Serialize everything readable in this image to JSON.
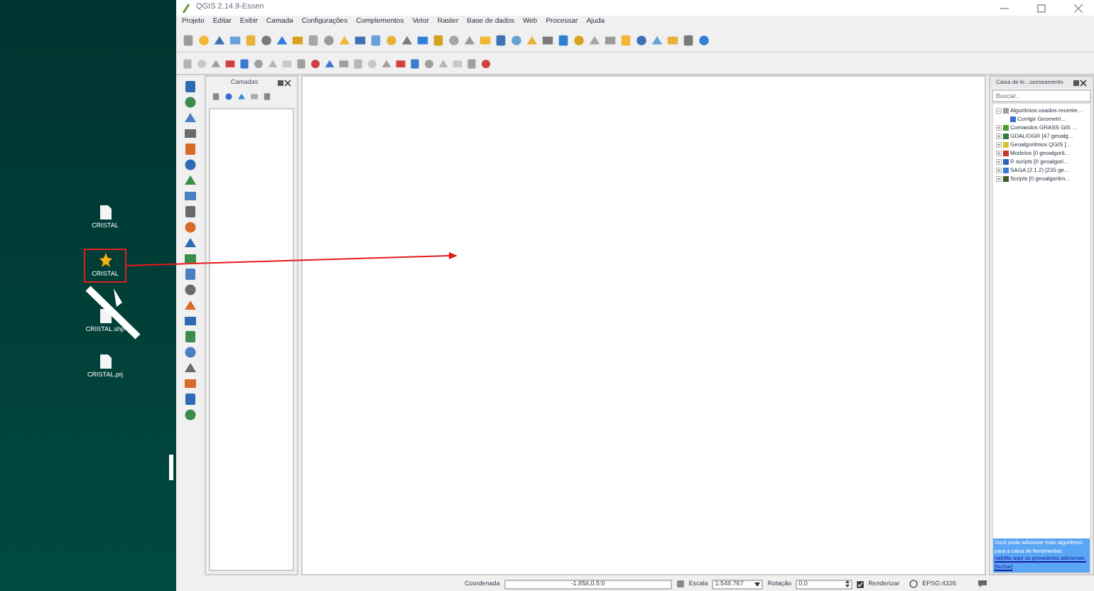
{
  "desktop": {
    "icons": [
      {
        "label": "CRISTAL",
        "kind": "file",
        "selected": false
      },
      {
        "label": "CRISTAL",
        "kind": "qgis",
        "selected": true
      },
      {
        "label": "CRISTAL.shp",
        "kind": "file",
        "selected": false
      },
      {
        "label": "CRISTAL.prj",
        "kind": "file",
        "selected": false
      }
    ]
  },
  "window": {
    "title": "QGIS 2.14.9-Essen"
  },
  "menu": [
    "Projeto",
    "Editar",
    "Exibir",
    "Camada",
    "Configurações",
    "Complementos",
    "Vetor",
    "Raster",
    "Base de dados",
    "Web",
    "Processar",
    "Ajuda"
  ],
  "layers_panel": {
    "title": "Camadas"
  },
  "processing_panel": {
    "title": "Caixa de fe...ocessamento",
    "search": {
      "placeholder": "Buscar..."
    },
    "tree": [
      {
        "label": "Algoritmos usados recente...",
        "expanded": true,
        "color": "#9aa0a6",
        "children": [
          {
            "label": "Corrigir Geometri...",
            "color": "#3b6fd1"
          }
        ]
      },
      {
        "label": "Comandos GRASS GIS ...",
        "expanded": false,
        "color": "#4a9a3a"
      },
      {
        "label": "GDAL/OGR [47 geoalg...",
        "expanded": false,
        "color": "#2b7a3b"
      },
      {
        "label": "Geoalgoritmos QGIS [...",
        "expanded": false,
        "color": "#d9c42a"
      },
      {
        "label": "Modelos [0 geoalgorit...",
        "expanded": false,
        "color": "#c0392b"
      },
      {
        "label": "R scripts [0 geoalgori...",
        "expanded": false,
        "color": "#2a62b5"
      },
      {
        "label": "SAGA (2.1.2) [235 ge...",
        "expanded": false,
        "color": "#3a7bd5"
      },
      {
        "label": "Scripts [0 geoalgoritm...",
        "expanded": false,
        "color": "#3d5a2a"
      }
    ],
    "notice": {
      "text": "Você pode adicionar mais algoritmos para a caixa de ferramentas,",
      "link": "habilite aqui os provedores adicionais.",
      "close": "[fechar]"
    }
  },
  "status_bar": {
    "coordinate_label": "Coordenada",
    "coordinate": "-1.858,0.5:0",
    "scale_label": "Escala",
    "scale": "1:548.767",
    "rotation_label": "Rotação",
    "rotation": "0,0",
    "render": {
      "label": "Renderizar",
      "checked": true
    },
    "crs": "EPSG:4326"
  }
}
